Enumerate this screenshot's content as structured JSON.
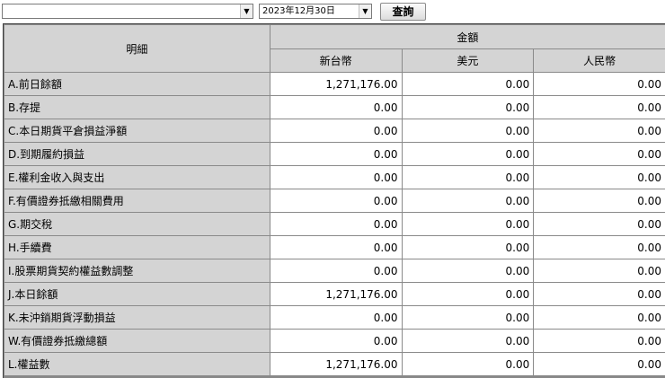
{
  "toolbar": {
    "account_value": "",
    "date_value": "2023年12月30日",
    "query_label": "查詢",
    "dropdown_arrow": "▼"
  },
  "table": {
    "detail_header": "明細",
    "amount_header": "金額",
    "currencies": [
      "新台幣",
      "美元",
      "人民幣"
    ],
    "rows": [
      {
        "label": "A.前日餘額",
        "values": [
          "1,271,176.00",
          "0.00",
          "0.00"
        ]
      },
      {
        "label": "B.存提",
        "values": [
          "0.00",
          "0.00",
          "0.00"
        ]
      },
      {
        "label": "C.本日期貨平倉損益淨額",
        "values": [
          "0.00",
          "0.00",
          "0.00"
        ]
      },
      {
        "label": "D.到期履約損益",
        "values": [
          "0.00",
          "0.00",
          "0.00"
        ]
      },
      {
        "label": "E.權利金收入與支出",
        "values": [
          "0.00",
          "0.00",
          "0.00"
        ]
      },
      {
        "label": "F.有價證券抵繳相關費用",
        "values": [
          "0.00",
          "0.00",
          "0.00"
        ]
      },
      {
        "label": "G.期交稅",
        "values": [
          "0.00",
          "0.00",
          "0.00"
        ]
      },
      {
        "label": "H.手續費",
        "values": [
          "0.00",
          "0.00",
          "0.00"
        ]
      },
      {
        "label": "I.股票期貨契約權益數調整",
        "values": [
          "0.00",
          "0.00",
          "0.00"
        ]
      },
      {
        "label": "J.本日餘額",
        "values": [
          "1,271,176.00",
          "0.00",
          "0.00"
        ]
      },
      {
        "label": "K.未沖銷期貨浮動損益",
        "values": [
          "0.00",
          "0.00",
          "0.00"
        ]
      },
      {
        "label": "W.有價證券抵繳總額",
        "values": [
          "0.00",
          "0.00",
          "0.00"
        ]
      },
      {
        "label": "L.權益數",
        "values": [
          "1,271,176.00",
          "0.00",
          "0.00"
        ]
      }
    ]
  }
}
